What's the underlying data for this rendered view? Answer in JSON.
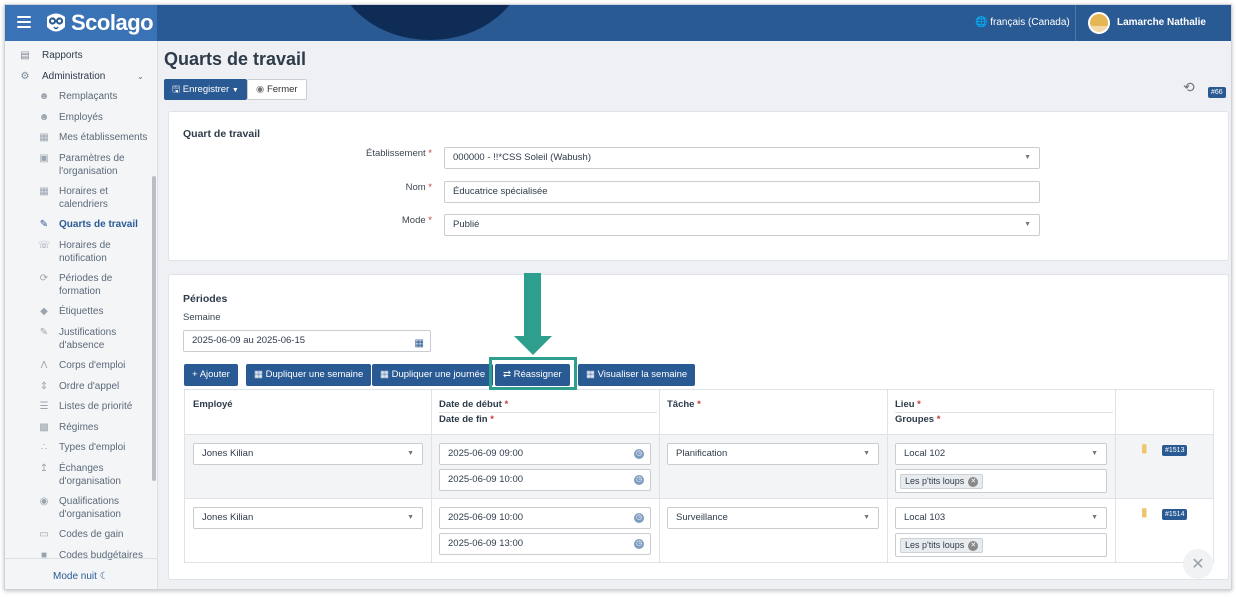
{
  "header": {
    "brand": "Scolago",
    "language": "français (Canada)",
    "user_name": "Lamarche Nathalie"
  },
  "sidebar": {
    "items": [
      {
        "label": "Rapports",
        "icon": "report-icon"
      },
      {
        "label": "Administration",
        "icon": "gear-icon"
      },
      {
        "label": "Remplaçants",
        "icon": "person-icon"
      },
      {
        "label": "Employés",
        "icon": "people-icon"
      },
      {
        "label": "Mes établissements",
        "icon": "building-icon"
      },
      {
        "label": "Paramètres de l'organisation",
        "icon": "settings-icon"
      },
      {
        "label": "Horaires et calendriers",
        "icon": "calendar-icon"
      },
      {
        "label": "Quarts de travail",
        "icon": "edit-icon"
      },
      {
        "label": "Horaires de notification",
        "icon": "notification-icon"
      },
      {
        "label": "Périodes de formation",
        "icon": "refresh-icon"
      },
      {
        "label": "Étiquettes",
        "icon": "tag-icon"
      },
      {
        "label": "Justifications d'absence",
        "icon": "edit-icon"
      },
      {
        "label": "Corps d'emploi",
        "icon": "figure-icon"
      },
      {
        "label": "Ordre d'appel",
        "icon": "sort-icon"
      },
      {
        "label": "Listes de priorité",
        "icon": "list-icon"
      },
      {
        "label": "Régimes",
        "icon": "group-icon"
      },
      {
        "label": "Types d'emploi",
        "icon": "hierarchy-icon"
      },
      {
        "label": "Échanges d'organisation",
        "icon": "upload-icon"
      },
      {
        "label": "Qualifications d'organisation",
        "icon": "badge-icon"
      },
      {
        "label": "Codes de gain",
        "icon": "money-icon"
      },
      {
        "label": "Codes budgétaires",
        "icon": "briefcase-icon"
      }
    ],
    "night_mode": "Mode nuit"
  },
  "page": {
    "title": "Quarts de travail",
    "save_label": "Enregistrer",
    "close_label": "Fermer",
    "record_badge": "#66"
  },
  "shift_form": {
    "title": "Quart de travail",
    "establishment_label": "Établissement",
    "establishment_value": "000000 - !!*CSS Soleil (Wabush)",
    "name_label": "Nom",
    "name_value": "Éducatrice spécialisée",
    "mode_label": "Mode",
    "mode_value": "Publié"
  },
  "periods": {
    "title": "Périodes",
    "week_label": "Semaine",
    "week_value": "2025-06-09 au 2025-06-15",
    "actions": {
      "add": "Ajouter",
      "duplicate_week": "Dupliquer une semaine",
      "duplicate_day": "Dupliquer une journée",
      "reassign": "Réassigner",
      "view_week": "Visualiser la semaine"
    },
    "columns": {
      "employee": "Employé",
      "start_date": "Date de début",
      "end_date": "Date de fin",
      "task": "Tâche",
      "place": "Lieu",
      "groups": "Groupes"
    },
    "rows": [
      {
        "employee": "Jones Kilian",
        "start": "2025-06-09 09:00",
        "end": "2025-06-09 10:00",
        "task": "Planification",
        "place": "Local 102",
        "group": "Les p'tits loups",
        "badge": "#1513"
      },
      {
        "employee": "Jones Kilian",
        "start": "2025-06-09 10:00",
        "end": "2025-06-09 13:00",
        "task": "Surveillance",
        "place": "Local 103",
        "group": "Les p'tits loups",
        "badge": "#1514"
      }
    ]
  },
  "colors": {
    "primary": "#2a5a93",
    "annotation": "#2e9e8e",
    "required": "#c73a3a"
  }
}
